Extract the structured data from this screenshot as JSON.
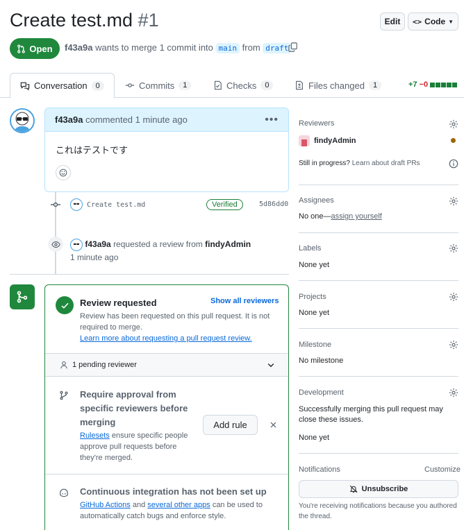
{
  "header": {
    "title": "Create test.md",
    "number": "#1",
    "edit_label": "Edit",
    "code_label": "Code",
    "status": "Open",
    "author": "f43a9a",
    "merge_text_1": "wants to merge 1 commit into",
    "base_branch": "main",
    "merge_text_2": "from",
    "head_branch": "draft"
  },
  "tabs": [
    {
      "label": "Conversation",
      "count": "0"
    },
    {
      "label": "Commits",
      "count": "1"
    },
    {
      "label": "Checks",
      "count": "0"
    },
    {
      "label": "Files changed",
      "count": "1"
    }
  ],
  "diffstat": {
    "additions": "+7",
    "deletions": "−0"
  },
  "comment": {
    "author": "f43a9a",
    "action": "commented",
    "time": "1 minute ago",
    "body": "これはテストです"
  },
  "commit": {
    "message": "Create test.md",
    "badge": "Verified",
    "sha": "5d86dd0"
  },
  "review_event": {
    "author": "f43a9a",
    "text": "requested a review from",
    "reviewer": "findyAdmin",
    "time": "1 minute ago"
  },
  "merge_box": {
    "review_title": "Review requested",
    "show_all": "Show all reviewers",
    "review_desc": "Review has been requested on this pull request. It is not required to merge.",
    "learn_more": "Learn more about requesting a pull request review.",
    "pending": "1 pending reviewer",
    "rule_title": "Require approval from specific reviewers before merging",
    "rulesets_link": "Rulesets",
    "rule_desc": "ensure specific people approve pull requests before they're merged.",
    "add_rule": "Add rule",
    "ci_title": "Continuous integration has not been set up",
    "ci_link1": "GitHub Actions",
    "ci_and": "and",
    "ci_link2": "several other apps",
    "ci_desc": "can be used to automatically catch bugs and enforce style."
  },
  "sidebar": {
    "reviewers_h": "Reviewers",
    "reviewer_name": "findyAdmin",
    "in_progress": "Still in progress?",
    "draft_link": "Learn about draft PRs",
    "assignees_h": "Assignees",
    "assignees_none": "No one—",
    "assign_link": "assign yourself",
    "labels_h": "Labels",
    "labels_val": "None yet",
    "projects_h": "Projects",
    "projects_val": "None yet",
    "milestone_h": "Milestone",
    "milestone_val": "No milestone",
    "development_h": "Development",
    "development_desc": "Successfully merging this pull request may close these issues.",
    "development_val": "None yet",
    "notifications_h": "Notifications",
    "customize": "Customize",
    "unsubscribe": "Unsubscribe",
    "notify_desc": "You're receiving notifications because you authored the thread."
  },
  "colors": {
    "green": "#1f883d",
    "blue": "#0969da",
    "pending_dot": "#9a6700"
  }
}
